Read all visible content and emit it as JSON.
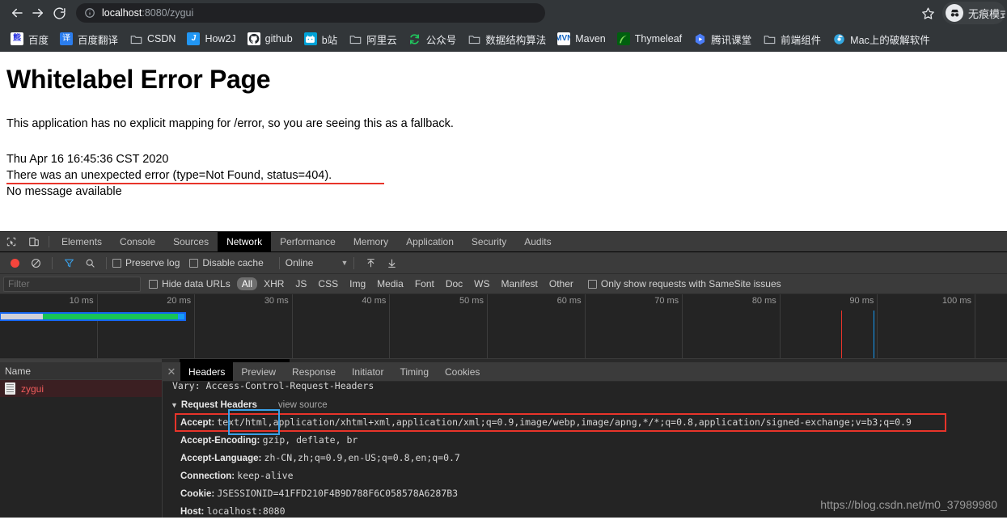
{
  "browser": {
    "nav": {
      "back": "back-arrow",
      "forward": "forward-arrow",
      "reload": "reload"
    },
    "omnibox": {
      "info_icon": "info-circle-icon",
      "host": "localhost",
      "path": ":8080/zygui",
      "full_url": "localhost:8080/zygui"
    },
    "star": "bookmark-star-icon",
    "incognito_label": "无痕模式",
    "bookmarks": [
      {
        "label": "百度",
        "icon": "baidu-icon",
        "icon_class": "ic-baidu",
        "glyph": "熊"
      },
      {
        "label": "百度翻译",
        "icon": "baidu-translate-icon",
        "icon_class": "ic-fanyi",
        "glyph": "译"
      },
      {
        "label": "CSDN",
        "icon": "folder-icon",
        "icon_class": "ic-folder",
        "glyph": ""
      },
      {
        "label": "How2J",
        "icon": "how2j-icon",
        "icon_class": "ic-how2j",
        "glyph": "J"
      },
      {
        "label": "github",
        "icon": "github-icon",
        "icon_class": "ic-github",
        "glyph": ""
      },
      {
        "label": "b站",
        "icon": "bilibili-icon",
        "icon_class": "ic-bzhan",
        "glyph": ""
      },
      {
        "label": "阿里云",
        "icon": "folder-icon",
        "icon_class": "ic-folder",
        "glyph": ""
      },
      {
        "label": "公众号",
        "icon": "wechat-official-icon",
        "icon_class": "ic-gzh",
        "glyph": ""
      },
      {
        "label": "数据结构算法",
        "icon": "folder-icon",
        "icon_class": "ic-folder",
        "glyph": ""
      },
      {
        "label": "Maven",
        "icon": "maven-icon",
        "icon_class": "ic-maven",
        "glyph": "MVN"
      },
      {
        "label": "Thymeleaf",
        "icon": "thymeleaf-icon",
        "icon_class": "ic-thyme",
        "glyph": ""
      },
      {
        "label": "腾讯课堂",
        "icon": "tencent-classroom-icon",
        "icon_class": "ic-tencent",
        "glyph": ""
      },
      {
        "label": "前端组件",
        "icon": "folder-icon",
        "icon_class": "ic-folder",
        "glyph": ""
      },
      {
        "label": "Mac上的破解软件",
        "icon": "mac-software-icon",
        "icon_class": "ic-mac",
        "glyph": ""
      }
    ]
  },
  "error_page": {
    "title": "Whitelabel Error Page",
    "description": "This application has no explicit mapping for /error, so you are seeing this as a fallback.",
    "timestamp": "Thu Apr 16 16:45:36 CST 2020",
    "error_line": "There was an unexpected error (type=Not Found, status=404).",
    "message": "No message available",
    "underline_color": "#e8342a"
  },
  "devtools": {
    "panel_tabs": [
      {
        "label": "Elements",
        "active": false
      },
      {
        "label": "Console",
        "active": false
      },
      {
        "label": "Sources",
        "active": false
      },
      {
        "label": "Network",
        "active": true
      },
      {
        "label": "Performance",
        "active": false
      },
      {
        "label": "Memory",
        "active": false
      },
      {
        "label": "Application",
        "active": false
      },
      {
        "label": "Security",
        "active": false
      },
      {
        "label": "Audits",
        "active": false
      }
    ],
    "toolbar": {
      "record_title": "record-button",
      "clear_title": "clear-button",
      "filter_title": "filter-icon",
      "search_title": "search-icon",
      "preserve_log": "Preserve log",
      "disable_cache": "Disable cache",
      "throttling": "Online",
      "import_title": "import-har-icon",
      "export_title": "export-har-icon"
    },
    "filterbar": {
      "filter_placeholder": "Filter",
      "hide_data_urls": "Hide data URLs",
      "types": [
        {
          "label": "All",
          "active": true
        },
        {
          "label": "XHR",
          "active": false
        },
        {
          "label": "JS",
          "active": false
        },
        {
          "label": "CSS",
          "active": false
        },
        {
          "label": "Img",
          "active": false
        },
        {
          "label": "Media",
          "active": false
        },
        {
          "label": "Font",
          "active": false
        },
        {
          "label": "Doc",
          "active": false
        },
        {
          "label": "WS",
          "active": false
        },
        {
          "label": "Manifest",
          "active": false
        },
        {
          "label": "Other",
          "active": false
        }
      ],
      "samesite_label": "Only show requests with SameSite issues"
    },
    "overview": {
      "ticks": [
        "10 ms",
        "20 ms",
        "30 ms",
        "40 ms",
        "50 ms",
        "60 ms",
        "70 ms",
        "80 ms",
        "90 ms",
        "100 ms"
      ],
      "dom_content_loaded_color": "#e8342a",
      "load_event_color": "#169bf5",
      "bar_colors": {
        "queue": "#d0d0d8",
        "wait": "#18c457",
        "download": "#169bf5",
        "outline": "#1565f0"
      }
    },
    "request_list": {
      "column_name": "Name",
      "rows": [
        {
          "name": "zygui",
          "selected": true,
          "failed": true
        }
      ]
    },
    "detail_tabs": [
      {
        "label": "Headers",
        "active": true
      },
      {
        "label": "Preview",
        "active": false
      },
      {
        "label": "Response",
        "active": false
      },
      {
        "label": "Initiator",
        "active": false
      },
      {
        "label": "Timing",
        "active": false
      },
      {
        "label": "Cookies",
        "active": false
      }
    ],
    "headers": {
      "vary_line": "Vary: Access-Control-Request-Headers",
      "section_title": "Request Headers",
      "view_source": "view source",
      "rows": [
        {
          "key": "Accept:",
          "value": "text/html,application/xhtml+xml,application/xml;q=0.9,image/webp,image/apng,*/*;q=0.8,application/signed-exchange;v=b3;q=0.9",
          "highlight_red": true,
          "highlight_blue": "text/html"
        },
        {
          "key": "Accept-Encoding:",
          "value": "gzip, deflate, br"
        },
        {
          "key": "Accept-Language:",
          "value": "zh-CN,zh;q=0.9,en-US;q=0.8,en;q=0.7"
        },
        {
          "key": "Connection:",
          "value": "keep-alive"
        },
        {
          "key": "Cookie:",
          "value": "JSESSIONID=41FFD210F4B9D788F6C058578A6287B3"
        },
        {
          "key": "Host:",
          "value": "localhost:8080"
        }
      ]
    },
    "watermark": "https://blog.csdn.net/m0_37989980"
  }
}
